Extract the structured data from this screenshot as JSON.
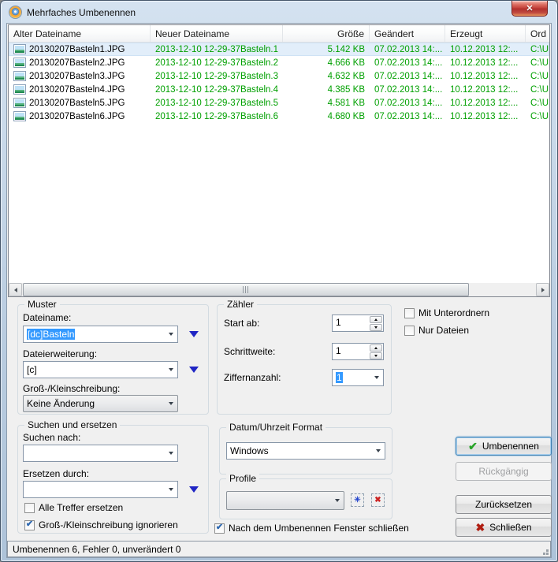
{
  "window": {
    "title": "Mehrfaches Umbenennen"
  },
  "icons": {
    "close": "✕",
    "check": "✔",
    "cross": "✖",
    "new_profile": "✳",
    "delete_profile": "✖"
  },
  "colors": {
    "new_name_green": "#00a000",
    "selection_blue": "#3399ff"
  },
  "list": {
    "columns": [
      {
        "key": "old",
        "label": "Alter Dateiname"
      },
      {
        "key": "new",
        "label": "Neuer Dateiname"
      },
      {
        "key": "size",
        "label": "Größe"
      },
      {
        "key": "modified",
        "label": "Geändert"
      },
      {
        "key": "created",
        "label": "Erzeugt"
      },
      {
        "key": "folder",
        "label": "Ord"
      }
    ],
    "rows": [
      {
        "old": "20130207Basteln1.JPG",
        "new": "2013-12-10 12-29-37Basteln.1",
        "size": "5.142 KB",
        "modified": "07.02.2013 14:...",
        "created": "10.12.2013 12:...",
        "folder": "C:\\U"
      },
      {
        "old": "20130207Basteln2.JPG",
        "new": "2013-12-10 12-29-37Basteln.2",
        "size": "4.666 KB",
        "modified": "07.02.2013 14:...",
        "created": "10.12.2013 12:...",
        "folder": "C:\\U"
      },
      {
        "old": "20130207Basteln3.JPG",
        "new": "2013-12-10 12-29-37Basteln.3",
        "size": "4.632 KB",
        "modified": "07.02.2013 14:...",
        "created": "10.12.2013 12:...",
        "folder": "C:\\U"
      },
      {
        "old": "20130207Basteln4.JPG",
        "new": "2013-12-10 12-29-37Basteln.4",
        "size": "4.385 KB",
        "modified": "07.02.2013 14:...",
        "created": "10.12.2013 12:...",
        "folder": "C:\\U"
      },
      {
        "old": "20130207Basteln5.JPG",
        "new": "2013-12-10 12-29-37Basteln.5",
        "size": "4.581 KB",
        "modified": "07.02.2013 14:...",
        "created": "10.12.2013 12:...",
        "folder": "C:\\U"
      },
      {
        "old": "20130207Basteln6.JPG",
        "new": "2013-12-10 12-29-37Basteln.6",
        "size": "4.680 KB",
        "modified": "07.02.2013 14:...",
        "created": "10.12.2013 12:...",
        "folder": "C:\\U"
      }
    ]
  },
  "muster": {
    "title": "Muster",
    "dateiname_label": "Dateiname:",
    "dateiname_value": "[dc]Basteln",
    "dateierweiterung_label": "Dateierweiterung:",
    "dateierweiterung_value": "[c]",
    "gross_klein_label": "Groß-/Kleinschreibung:",
    "gross_klein_value": "Keine Änderung"
  },
  "zaehler": {
    "title": "Zähler",
    "start_label": "Start ab:",
    "start_value": "1",
    "schritt_label": "Schrittweite:",
    "schritt_value": "1",
    "ziffern_label": "Ziffernanzahl:",
    "ziffern_value": "1"
  },
  "options": {
    "mit_unterordnern": "Mit Unterordnern",
    "nur_dateien": "Nur Dateien"
  },
  "suchen": {
    "title": "Suchen und ersetzen",
    "suchen_label": "Suchen nach:",
    "ersetzen_label": "Ersetzen durch:",
    "alle_treffer": "Alle Treffer ersetzen",
    "ignore_case": "Groß-/Kleinschreibung ignorieren"
  },
  "datum": {
    "title": "Datum/Uhrzeit Format",
    "value": "Windows"
  },
  "profile": {
    "title": "Profile",
    "value": ""
  },
  "close_checkbox_label": "Nach dem Umbenennen Fenster schließen",
  "buttons": {
    "umbenennen": "Umbenennen",
    "rueckgaengig": "Rückgängig",
    "zuruecksetzen": "Zurücksetzen",
    "schliessen": "Schließen"
  },
  "statusbar": {
    "text": "Umbenennen 6, Fehler 0, unverändert 0"
  }
}
